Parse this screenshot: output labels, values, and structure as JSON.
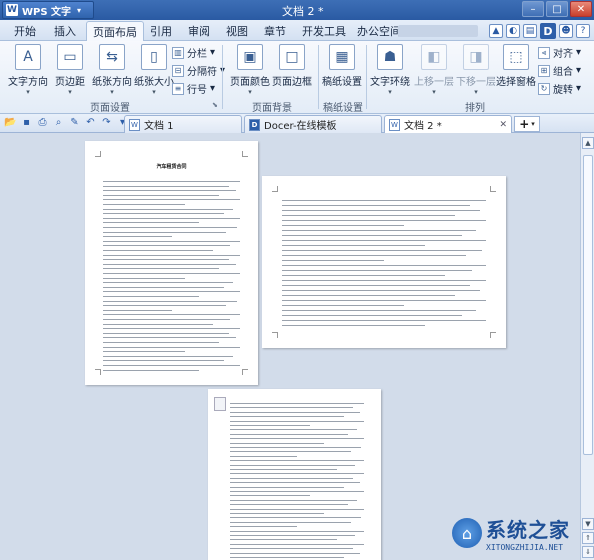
{
  "app": {
    "name": "WPS 文字",
    "logo": "W",
    "window_title": "文档 2 *"
  },
  "menu": {
    "tabs": [
      "开始",
      "插入",
      "页面布局",
      "引用",
      "审阅",
      "视图",
      "章节",
      "开发工具",
      "办公空间"
    ],
    "active": "页面布局"
  },
  "ribbon": {
    "page_setup": {
      "text_dir": "文字方向",
      "margins": "页边距",
      "orientation": "纸张方向",
      "size": "纸张大小",
      "columns": "分栏",
      "breaks": "分隔符",
      "line_num": "行号",
      "group": "页面设置"
    },
    "background": {
      "color": "页面颜色",
      "border": "页面边框",
      "group": "页面背景"
    },
    "manuscript": {
      "label": "稿纸设置",
      "group": "稿纸设置"
    },
    "arrange": {
      "wrap": "文字环绕",
      "forward": "上移一层",
      "backward": "下移一层",
      "select": "选择窗格",
      "align": "对齐",
      "group_btn": "组合",
      "rotate": "旋转",
      "group": "排列"
    }
  },
  "doc_tabs": [
    {
      "label": "文档 1",
      "active": false
    },
    {
      "label": "Docer-在线模板",
      "active": false
    },
    {
      "label": "文档 2 *",
      "active": true
    }
  ],
  "pages": {
    "contract_title": "汽车租赁合同"
  },
  "watermark": {
    "name": "系统之家",
    "url": "XITONGZHIJIA.NET"
  }
}
